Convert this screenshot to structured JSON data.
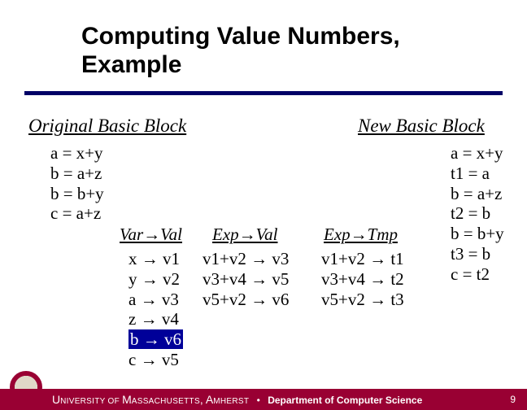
{
  "title": "Computing Value Numbers, Example",
  "headings": {
    "original": "Original Basic Block",
    "new_block": "New Basic Block",
    "varval": "Var→Val",
    "expval": "Exp→Val",
    "exptmp": "Exp→Tmp"
  },
  "original_block": [
    "a = x+y",
    "b = a+z",
    "b = b+y",
    "c = a+z"
  ],
  "new_block": [
    "a = x+y",
    "t1 = a",
    "b = a+z",
    "t2 = b",
    "b = b+y",
    "t3 = b",
    "c = t2"
  ],
  "varval": [
    {
      "text": "x → v1",
      "hl": false
    },
    {
      "text": "y → v2",
      "hl": false
    },
    {
      "text": "a → v3",
      "hl": false
    },
    {
      "text": "z → v4",
      "hl": false
    },
    {
      "text": "b → v6",
      "hl": true
    },
    {
      "text": "c → v5",
      "hl": false
    }
  ],
  "expval": [
    "v1+v2 → v3",
    "v3+v4 → v5",
    "v5+v2 → v6"
  ],
  "exptmp": [
    "v1+v2 → t1",
    "v3+v4 → t2",
    "v5+v2 → t3"
  ],
  "footer": {
    "univ_lead": "U",
    "univ_rest": "NIVERSITY OF ",
    "mass_lead": "M",
    "mass_rest": "ASSACHUSETTS",
    "amh_lead": ", A",
    "amh_rest": "MHERST",
    "dot": "•",
    "dept": "Department of Computer Science"
  },
  "page": "9"
}
